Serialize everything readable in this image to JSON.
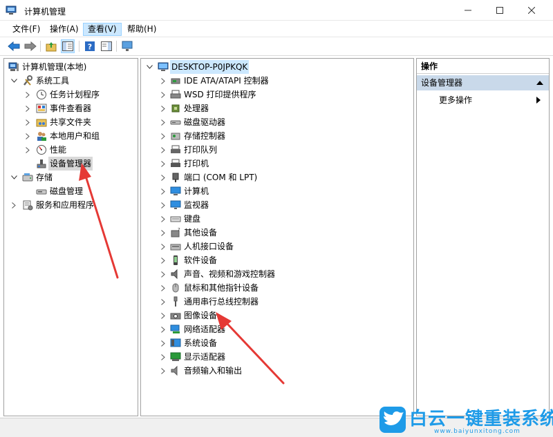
{
  "window": {
    "title": "计算机管理"
  },
  "menu": {
    "items": [
      {
        "label": "文件(F)"
      },
      {
        "label": "操作(A)"
      },
      {
        "label": "查看(V)"
      },
      {
        "label": "帮助(H)"
      }
    ]
  },
  "left_tree": {
    "root": "计算机管理(本地)",
    "system_tools": "系统工具",
    "task_scheduler": "任务计划程序",
    "event_viewer": "事件查看器",
    "shared_folders": "共享文件夹",
    "local_users": "本地用户和组",
    "performance": "性能",
    "device_manager": "设备管理器",
    "storage": "存储",
    "disk_management": "磁盘管理",
    "services_apps": "服务和应用程序"
  },
  "device_tree": {
    "computer": "DESKTOP-P0JPKQK",
    "categories": [
      "IDE ATA/ATAPI 控制器",
      "WSD 打印提供程序",
      "处理器",
      "磁盘驱动器",
      "存储控制器",
      "打印队列",
      "打印机",
      "端口 (COM 和 LPT)",
      "计算机",
      "监视器",
      "键盘",
      "其他设备",
      "人机接口设备",
      "软件设备",
      "声音、视频和游戏控制器",
      "鼠标和其他指针设备",
      "通用串行总线控制器",
      "图像设备",
      "网络适配器",
      "系统设备",
      "显示适配器",
      "音频输入和输出"
    ]
  },
  "actions": {
    "header": "操作",
    "section": "设备管理器",
    "more": "更多操作"
  },
  "watermark": {
    "title": "白云一键重装系统",
    "url": "www.baiyunxitong.com"
  },
  "colors": {
    "accent": "#1e9be8",
    "arrow": "#e53935",
    "section_bg": "#c9d9ea"
  }
}
